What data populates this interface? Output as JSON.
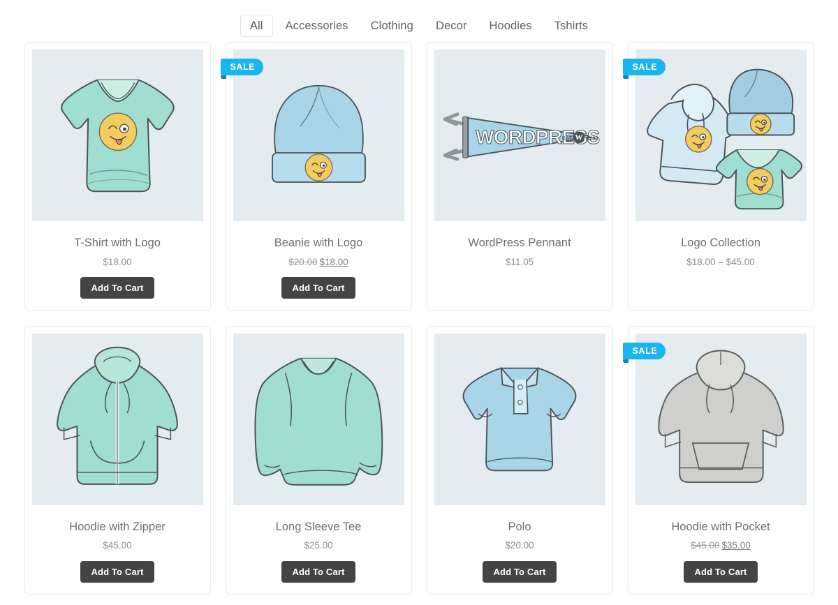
{
  "filters": {
    "tabs": [
      {
        "label": "All",
        "active": true
      },
      {
        "label": "Accessories",
        "active": false
      },
      {
        "label": "Clothing",
        "active": false
      },
      {
        "label": "Decor",
        "active": false
      },
      {
        "label": "Hoodies",
        "active": false
      },
      {
        "label": "Tshirts",
        "active": false
      }
    ]
  },
  "badges": {
    "sale": "SALE"
  },
  "buttons": {
    "add_to_cart": "Add To Cart"
  },
  "colors": {
    "sale_badge": "#1ab4ef",
    "thumb_background": "#e5ecef",
    "button": "#444446",
    "card_border": "#eceded",
    "title_text": "#6a7173",
    "price_text": "#8b9193",
    "mint": "#9fded0",
    "light_blue": "#a8d5e8",
    "grey": "#cfd0cd",
    "emoji_yellow": "#f2cc61"
  },
  "products": [
    {
      "name": "T-Shirt with Logo",
      "price": "$18.00",
      "on_sale": false,
      "has_add_to_cart": true,
      "icon": "tshirt-mint-logo-icon"
    },
    {
      "name": "Beanie with Logo",
      "price_old": "$20.00",
      "price_new": "$18.00",
      "on_sale": true,
      "has_add_to_cart": true,
      "icon": "beanie-blue-logo-icon"
    },
    {
      "name": "WordPress Pennant",
      "price": "$11.05",
      "on_sale": false,
      "has_add_to_cart": false,
      "icon": "pennant-icon",
      "pennant_text": "WORDPRESS",
      "pennant_est": "EST. 2003"
    },
    {
      "name": "Logo Collection",
      "price": "$18.00 – $45.00",
      "on_sale": true,
      "has_add_to_cart": false,
      "icon": "logo-collection-icon"
    },
    {
      "name": "Hoodie with Zipper",
      "price": "$45.00",
      "on_sale": false,
      "has_add_to_cart": true,
      "icon": "hoodie-zipper-mint-icon"
    },
    {
      "name": "Long Sleeve Tee",
      "price": "$25.00",
      "on_sale": false,
      "has_add_to_cart": true,
      "icon": "long-sleeve-tee-mint-icon"
    },
    {
      "name": "Polo",
      "price": "$20.00",
      "on_sale": false,
      "has_add_to_cart": true,
      "icon": "polo-blue-icon"
    },
    {
      "name": "Hoodie with Pocket",
      "price_old": "$45.00",
      "price_new": "$35.00",
      "on_sale": true,
      "has_add_to_cart": true,
      "icon": "hoodie-pocket-grey-icon"
    }
  ]
}
